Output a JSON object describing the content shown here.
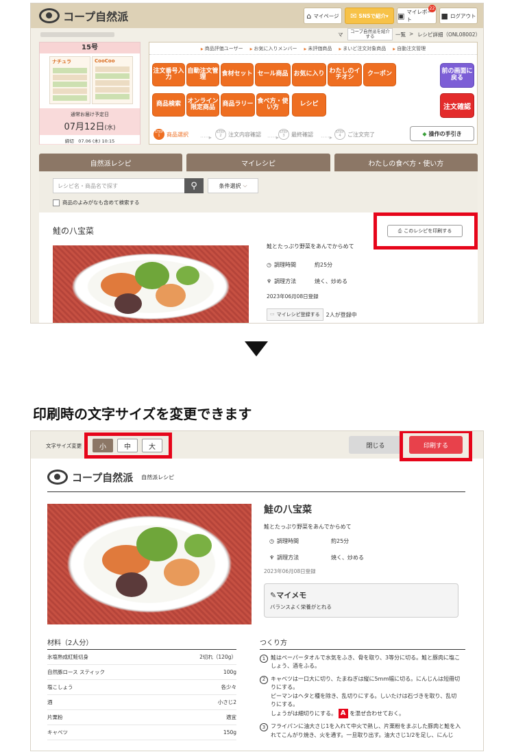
{
  "site": {
    "logo_text": "コープ自然派",
    "header_buttons": [
      "マイページ",
      "SNSで紹介▾",
      "マイレポート",
      "ログアウト"
    ],
    "report_badge": "22",
    "sns_dropdown": "コープ自然派を紹介する",
    "breadcrumb_tail_1": "マ",
    "breadcrumb_tail_2": "一覧",
    "breadcrumb_current": "レシピ詳細（ONL08002）",
    "breadcrumb_sep": ">"
  },
  "issue": {
    "number": "15号",
    "flyer1_title": "ナチュラ",
    "flyer2_title": "CooCoo",
    "delivery_label": "通常お届け予定日",
    "delivery_month_day": "07月12日",
    "delivery_weekday": "(水)",
    "deadline": "締切　07.06 (木) 10:15"
  },
  "menu": {
    "links": [
      "商品評価ユーザー",
      "お気に入りメンバー",
      "未評価商品",
      "まいど注文対象商品",
      "自動注文管理"
    ],
    "row1": [
      "注文番号入力",
      "自動注文管理",
      "食材セット",
      "セール商品",
      "お気に入り",
      "わたしのイチオシ",
      "クーポン"
    ],
    "row2": [
      "商品検索",
      "オンライン限定商品",
      "商品ラリー",
      "食べ方・使い方",
      "レシピ"
    ],
    "back_button": "前の画面に戻る",
    "confirm_button": "注文確認",
    "steps": [
      "商品選択",
      "注文内容確認",
      "最終確認",
      "ご注文完了"
    ],
    "step_nums": [
      "STEP 1",
      "STEP 2",
      "STEP 3",
      "STEP 4"
    ],
    "guide_button": "操作の手引き"
  },
  "tabs": [
    "自然派レシピ",
    "マイレシピ",
    "わたしの食べ方・使い方"
  ],
  "search": {
    "placeholder": "レシピ名・商品名で探す",
    "condition_button": "条件選択",
    "reading_checkbox": "商品のよみがなも含めて検索する"
  },
  "recipe": {
    "title": "鮭の八宝菜",
    "print_button": "このレシピを印刷する",
    "description": "鮭とたっぷり野菜をあんでからめて",
    "time_label": "調理時間",
    "time_value": "約25分",
    "method_label": "調理方法",
    "method_value": "焼く、炒める",
    "registered": "2023年06月08日登録",
    "myrecipe_button": "マイレシピ登録する",
    "registered_count": "2人が登録中"
  },
  "caption": "印刷時の文字サイズを変更できます",
  "print": {
    "size_label": "文字サイズ変更",
    "sizes": [
      "小",
      "中",
      "大"
    ],
    "close_button": "閉じる",
    "print_button": "印刷する",
    "logo_sub": "自然派レシピ",
    "memo_title": "マイメモ",
    "memo_text": "バランスよく栄養がとれる",
    "ingredients_title": "材料（2人分）",
    "ingredients": [
      {
        "name": "氷塩熟成紅鮭切身",
        "qty": "2切れ（120g）"
      },
      {
        "name": "自然豚ロース スティック",
        "qty": "100g"
      },
      {
        "name": "塩こしょう",
        "qty": "各少々"
      },
      {
        "name": "酒",
        "qty": "小さじ2"
      },
      {
        "name": "片栗粉",
        "qty": "適宜"
      },
      {
        "name": "キャベツ",
        "qty": "150g"
      }
    ],
    "steps_title": "つくり方",
    "steps": [
      {
        "n": "1",
        "lines": [
          "鮭はペーパータオルで水気をふき、骨を取り、3等分に切る。鮭と豚肉に塩こ",
          "しょう、酒をふる。"
        ]
      },
      {
        "n": "2",
        "lines": [
          "キャベツは一口大に切り、たまねぎは縦に5mm幅に切る。にんじんは短冊切",
          "りにする。",
          "ピーマンはヘタと種を除き、乱切りにする。しいたけは石づきを取り、乱切",
          "りにする。"
        ],
        "extra_pre": "しょうがは細切りにする。",
        "extra_mark": "A",
        "extra_post": "を混ぜ合わせておく。"
      },
      {
        "n": "3",
        "lines": [
          "フライパンに油大さじ1を入れて中火で熱し、片栗粉をまぶした豚肉と鮭を入",
          "れてこんがり焼き、火を通す。一旦取り出す。油大さじ1/2を足し、にんじ"
        ]
      }
    ]
  }
}
